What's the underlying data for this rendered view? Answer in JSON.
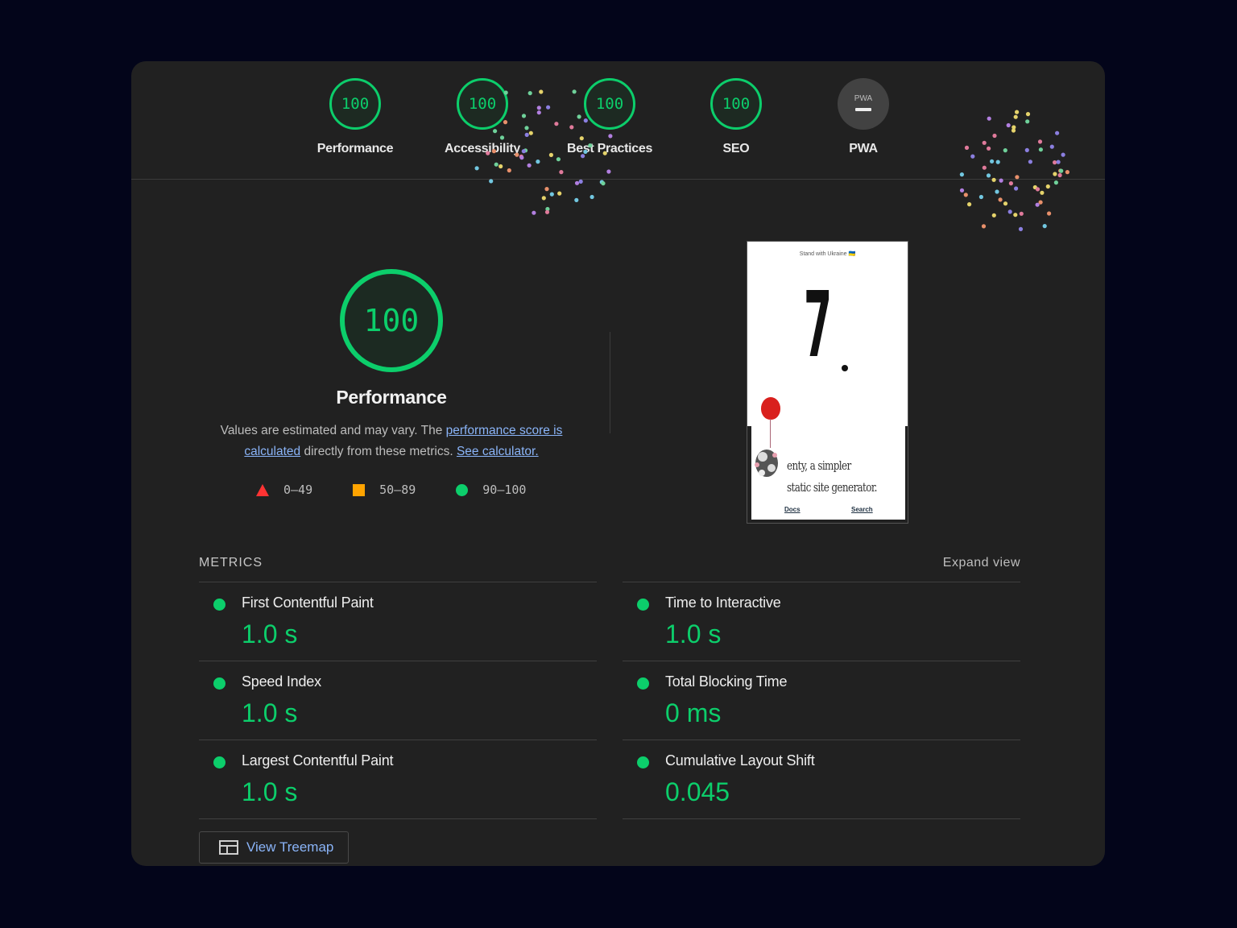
{
  "top_gauges": [
    {
      "label": "Performance",
      "score": "100"
    },
    {
      "label": "Accessibility",
      "score": "100"
    },
    {
      "label": "Best Practices",
      "score": "100"
    },
    {
      "label": "SEO",
      "score": "100"
    },
    {
      "label": "PWA",
      "score": "PWA"
    }
  ],
  "performance": {
    "score": "100",
    "title": "Performance",
    "desc_prefix": "Values are estimated and may vary. The ",
    "link1": "performance score is calculated",
    "desc_mid": " directly from these metrics. ",
    "link2": "See calculator."
  },
  "legend": [
    {
      "range": "0–49"
    },
    {
      "range": "50–89"
    },
    {
      "range": "90–100"
    }
  ],
  "screenshot": {
    "banner": "Stand with Ukraine 🇺🇦",
    "big_glyph": "7",
    "tagline": "enty, a simpler static site generator.",
    "nav_docs": "Docs",
    "nav_search": "Search"
  },
  "metrics": {
    "heading": "METRICS",
    "expand": "Expand view",
    "left": [
      {
        "name": "First Contentful Paint",
        "value": "1.0 s"
      },
      {
        "name": "Speed Index",
        "value": "1.0 s"
      },
      {
        "name": "Largest Contentful Paint",
        "value": "1.0 s"
      }
    ],
    "right": [
      {
        "name": "Time to Interactive",
        "value": "1.0 s"
      },
      {
        "name": "Total Blocking Time",
        "value": "0 ms"
      },
      {
        "name": "Cumulative Layout Shift",
        "value": "0.045"
      }
    ]
  },
  "treemap_button": "View Treemap",
  "colors": {
    "pass": "#0cce6b",
    "average": "#ffa400",
    "fail": "#ff3333",
    "link": "#8ab4f8",
    "background": "#03051a",
    "card": "#212121"
  }
}
